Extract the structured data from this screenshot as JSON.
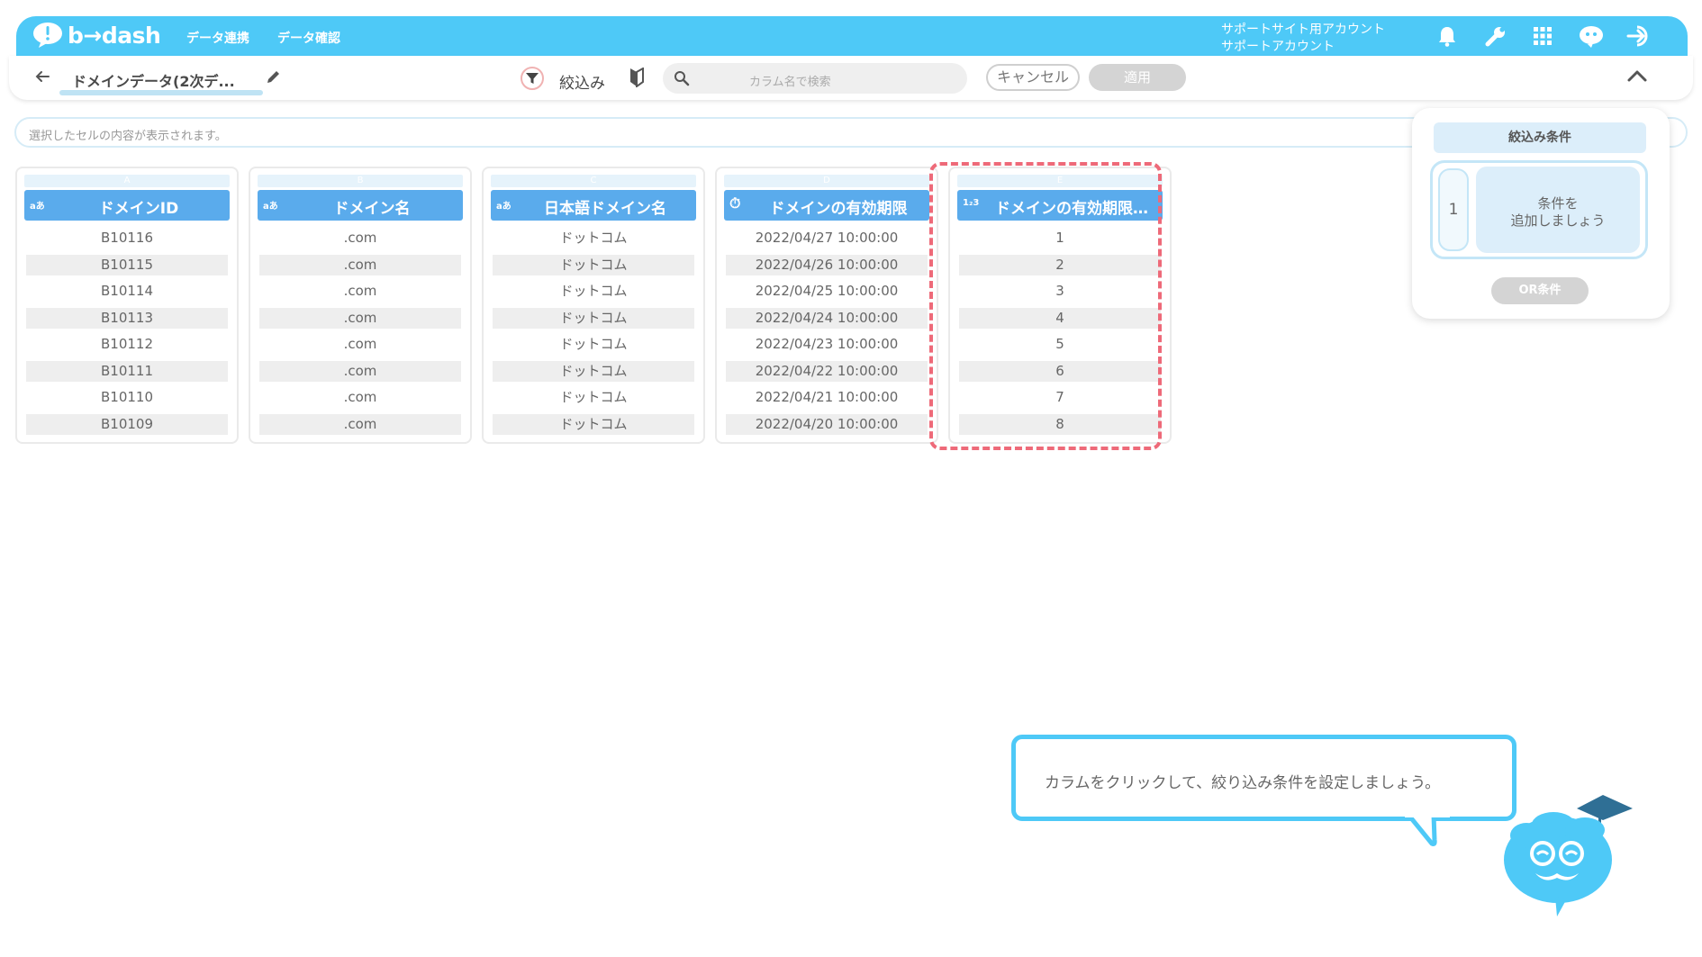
{
  "app": {
    "logo_text": "b→dash",
    "nav": [
      "データ連携",
      "データ確認"
    ],
    "account_line1": "サポートサイト用アカウント",
    "account_line2": "サポートアカウント"
  },
  "toolbar": {
    "dataset_title": "ドメインデータ(2次デ...",
    "filter_label": "絞込み",
    "search_placeholder": "カラム名で検索",
    "cancel_label": "キャンセル",
    "apply_label": "適用"
  },
  "cellbar": {
    "placeholder": "選択したセルの内容が表示されます。"
  },
  "table": {
    "columns": [
      {
        "letter": "A",
        "type": "aあ",
        "name": "ドメインID",
        "values": [
          "B10116",
          "B10115",
          "B10114",
          "B10113",
          "B10112",
          "B10111",
          "B10110",
          "B10109"
        ]
      },
      {
        "letter": "B",
        "type": "aあ",
        "name": "ドメイン名",
        "values": [
          ".com",
          ".com",
          ".com",
          ".com",
          ".com",
          ".com",
          ".com",
          ".com"
        ]
      },
      {
        "letter": "C",
        "type": "aあ",
        "name": "日本語ドメイン名",
        "values": [
          "ドットコム",
          "ドットコム",
          "ドットコム",
          "ドットコム",
          "ドットコム",
          "ドットコム",
          "ドットコム",
          "ドットコム"
        ]
      },
      {
        "letter": "D",
        "type": "⏱",
        "name": "ドメインの有効期限",
        "values": [
          "2022/04/27 10:00:00",
          "2022/04/26 10:00:00",
          "2022/04/25 10:00:00",
          "2022/04/24 10:00:00",
          "2022/04/23 10:00:00",
          "2022/04/22 10:00:00",
          "2022/04/21 10:00:00",
          "2022/04/20 10:00:00"
        ]
      },
      {
        "letter": "E",
        "type": "1₂3",
        "name": "ドメインの有効期限…",
        "values": [
          "1",
          "2",
          "3",
          "4",
          "5",
          "6",
          "7",
          "8"
        ]
      }
    ]
  },
  "filter_panel": {
    "title": "絞込み条件",
    "condition_number": "1",
    "condition_line1": "条件を",
    "condition_line2": "追加しましょう",
    "or_label": "OR条件"
  },
  "guide": {
    "message": "カラムをクリックして、絞り込み条件を設定しましょう。"
  },
  "colors": {
    "brand": "#4ec9f7",
    "column_header": "#5aabec",
    "highlight": "#ee6a79",
    "panel_fill": "#dceefa"
  }
}
